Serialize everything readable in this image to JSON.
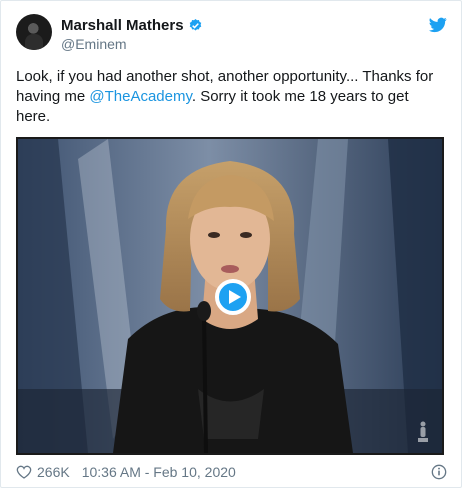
{
  "tweet": {
    "author_name": "Marshall Mathers",
    "handle": "@Eminem",
    "text_before": "Look, if you had another shot, another opportunity... Thanks for having me ",
    "mention": "@TheAcademy",
    "text_after": ".  Sorry it took me 18 years to get here.",
    "like_count": "266K",
    "timestamp": "10:36 AM - Feb 10, 2020"
  },
  "colors": {
    "link": "#1b95e0",
    "brand": "#1da1f2",
    "secondary_text": "#657786"
  },
  "icons": [
    "verified-badge-icon",
    "twitter-bird-icon",
    "play-icon",
    "heart-icon",
    "info-icon",
    "oscar-statuette-icon"
  ]
}
